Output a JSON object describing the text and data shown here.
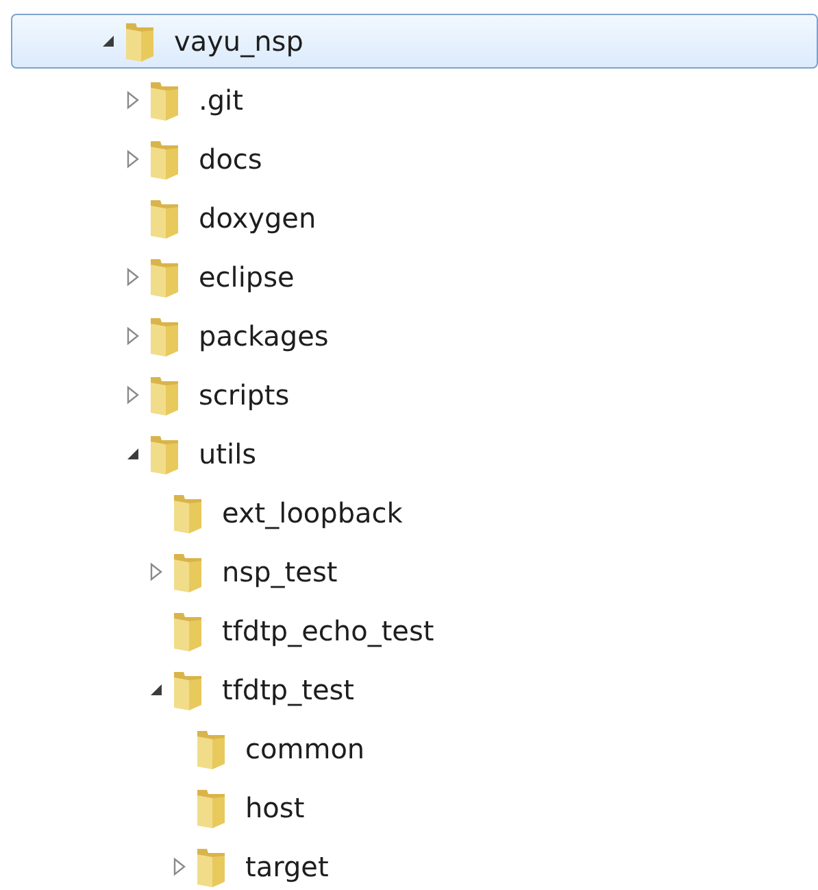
{
  "tree": [
    {
      "label": "vayu_nsp",
      "kind": "branch",
      "expanded": true,
      "selected": true,
      "children": [
        {
          "label": ".git",
          "kind": "branch",
          "expanded": false,
          "selected": false
        },
        {
          "label": "docs",
          "kind": "branch",
          "expanded": false,
          "selected": false
        },
        {
          "label": "doxygen",
          "kind": "leaf",
          "selected": false
        },
        {
          "label": "eclipse",
          "kind": "branch",
          "expanded": false,
          "selected": false
        },
        {
          "label": "packages",
          "kind": "branch",
          "expanded": false,
          "selected": false
        },
        {
          "label": "scripts",
          "kind": "branch",
          "expanded": false,
          "selected": false
        },
        {
          "label": "utils",
          "kind": "branch",
          "expanded": true,
          "selected": false,
          "children": [
            {
              "label": "ext_loopback",
              "kind": "leaf",
              "selected": false
            },
            {
              "label": "nsp_test",
              "kind": "branch",
              "expanded": false,
              "selected": false
            },
            {
              "label": "tfdtp_echo_test",
              "kind": "leaf",
              "selected": false
            },
            {
              "label": "tfdtp_test",
              "kind": "branch",
              "expanded": true,
              "selected": false,
              "children": [
                {
                  "label": "common",
                  "kind": "leaf",
                  "selected": false
                },
                {
                  "label": "host",
                  "kind": "leaf",
                  "selected": false
                },
                {
                  "label": "target",
                  "kind": "branch",
                  "expanded": false,
                  "selected": false
                }
              ]
            }
          ]
        }
      ]
    }
  ]
}
